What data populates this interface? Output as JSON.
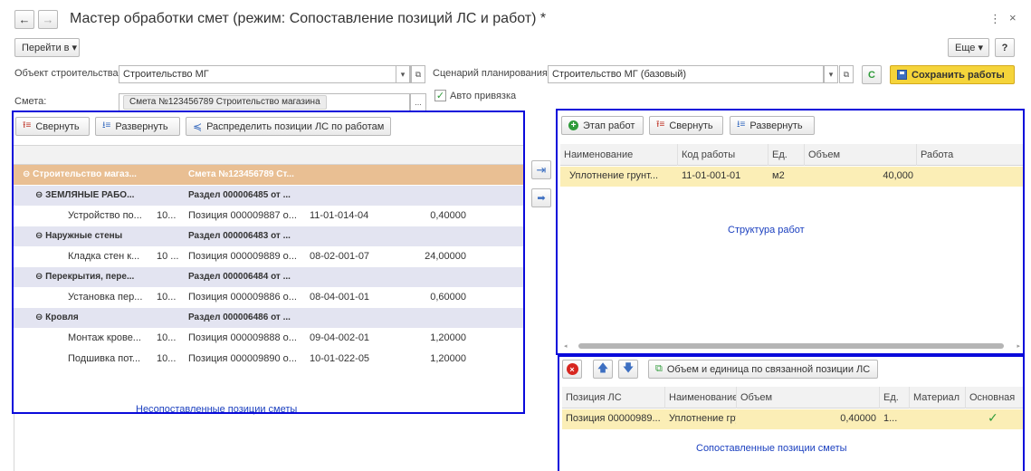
{
  "window": {
    "title": "Мастер обработки смет (режим: Сопоставление позиций ЛС и работ) *",
    "back_icon": "←",
    "fwd_icon": "→",
    "menu_icon": "⋮",
    "close_icon": "×"
  },
  "toolbar": {
    "goto_label": "Перейти в ▾",
    "more_label": "Еще ▾",
    "help_label": "?"
  },
  "form": {
    "object_label": "Объект строительства:",
    "object_value": "Строительство МГ",
    "scenario_label": "Сценарий планирования:",
    "scenario_value": "Строительство МГ (базовый)",
    "save_label": "Сохранить работы",
    "estimate_label": "Смета:",
    "estimate_value": "Смета №123456789 Строительство магазина",
    "auto_link_label": "Авто привязка",
    "ellipsis": "...",
    "dropdown_glyph": "▾",
    "open_glyph": "⧉",
    "refresh_glyph": "C"
  },
  "left": {
    "collapse_label": "Свернуть",
    "expand_label": "Развернуть",
    "distribute_label": "Распределить позиции ЛС по работам",
    "caption": "Несопоставленные позиции сметы",
    "rows": [
      {
        "kind": "top",
        "c1": "⊖  Строительство магаз...",
        "c2": "",
        "c3": "Смета №123456789 Ст...",
        "c4": "",
        "c5": ""
      },
      {
        "kind": "section",
        "c1": "⊖  ЗЕМЛЯНЫЕ РАБО...",
        "c2": "",
        "c3": "Раздел 000006485 от ...",
        "c4": "",
        "c5": ""
      },
      {
        "kind": "item",
        "c1": "Устройство по...",
        "c2": "10...",
        "c3": "Позиция 000009887 о...",
        "c4": "11-01-014-04",
        "c5": "0,40000"
      },
      {
        "kind": "section",
        "c1": "⊖  Наружные стены",
        "c2": "",
        "c3": "Раздел 000006483 от ...",
        "c4": "",
        "c5": ""
      },
      {
        "kind": "item",
        "c1": "Кладка стен к...",
        "c2": "10 ...",
        "c3": "Позиция 000009889 о...",
        "c4": "08-02-001-07",
        "c5": "24,00000"
      },
      {
        "kind": "section",
        "c1": "⊖  Перекрытия, пере...",
        "c2": "",
        "c3": "Раздел 000006484 от ...",
        "c4": "",
        "c5": ""
      },
      {
        "kind": "item",
        "c1": "Установка пер...",
        "c2": "10...",
        "c3": "Позиция 000009886 о...",
        "c4": "08-04-001-01",
        "c5": "0,60000"
      },
      {
        "kind": "section",
        "c1": "⊖  Кровля",
        "c2": "",
        "c3": "Раздел 000006486 от ...",
        "c4": "",
        "c5": ""
      },
      {
        "kind": "item",
        "c1": "Монтаж крове...",
        "c2": "10...",
        "c3": "Позиция 000009888 о...",
        "c4": "09-04-002-01",
        "c5": "1,20000"
      },
      {
        "kind": "item",
        "c1": "Подшивка пот...",
        "c2": "10...",
        "c3": "Позиция 000009890 о...",
        "c4": "10-01-022-05",
        "c5": "1,20000"
      }
    ]
  },
  "middle": {
    "move_right_icon": "⇥",
    "arrow_right_icon": "➡"
  },
  "work": {
    "stage_label": "Этап работ",
    "collapse_label": "Свернуть",
    "expand_label": "Развернуть",
    "headers": [
      "Наименование",
      "Код работы",
      "Ед.",
      "Объем",
      "Работа"
    ],
    "row": {
      "name": "Уплотнение грунт...",
      "code": "11-01-001-01",
      "unit": "м2",
      "volume": "40,000",
      "work": ""
    },
    "caption": "Структура работ"
  },
  "matched": {
    "volume_unit_label": "Объем и единица по связанной позиции ЛС",
    "headers": [
      "Позиция ЛС",
      "Наименование",
      "Объем",
      "Ед.",
      "Материал",
      "Основная"
    ],
    "row": {
      "position": "Позиция 00000989...",
      "name": "Уплотнение гру...",
      "volume": "0,40000",
      "unit": "1...",
      "material": "",
      "main": "✓"
    },
    "caption": "Сопоставленные позиции сметы"
  },
  "colors": {
    "accent_border": "#0a0adb",
    "save_bg": "#f5d43a",
    "selected_row": "#fbeeb6",
    "top_row": "#e9bf93",
    "section_row": "#e3e4f1"
  }
}
